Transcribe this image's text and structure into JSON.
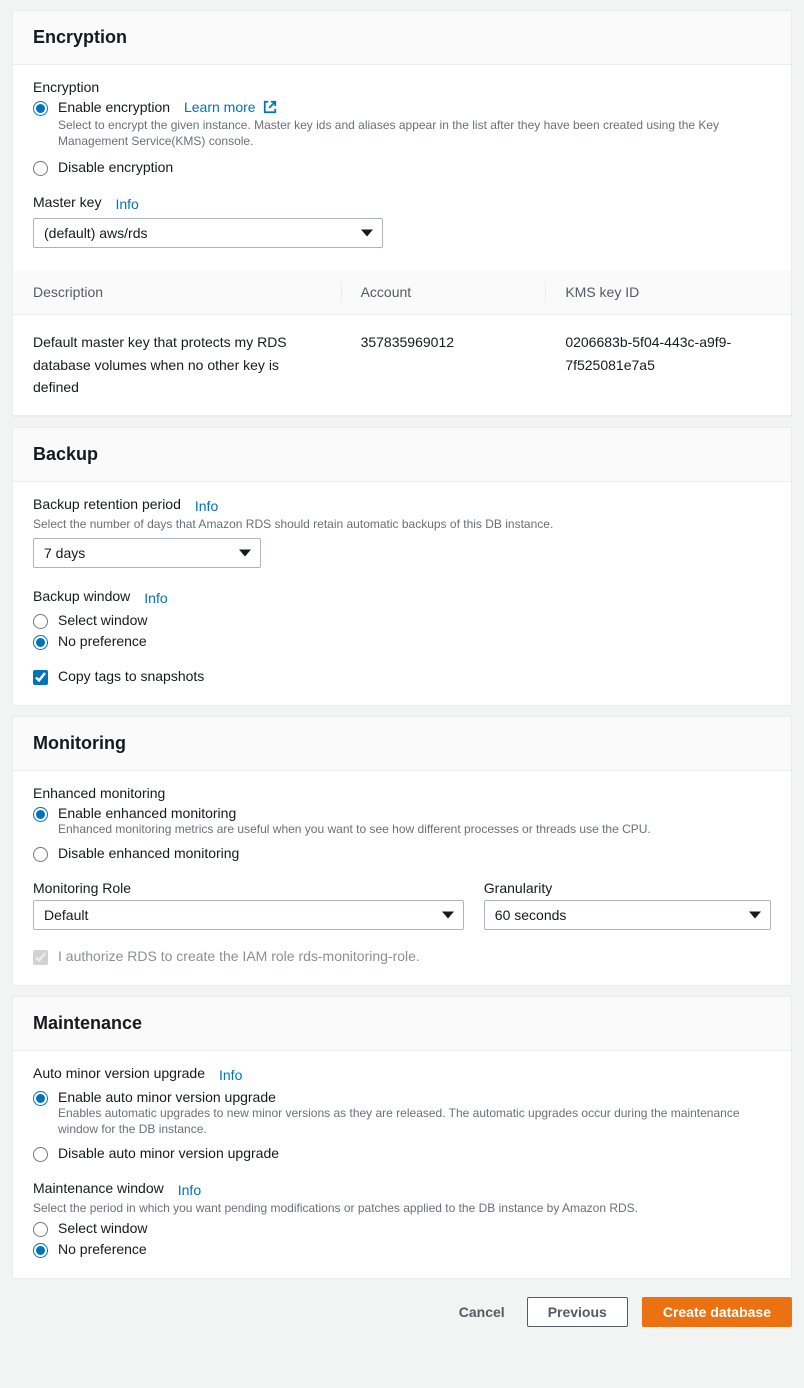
{
  "encryption": {
    "title": "Encryption",
    "sectionLabel": "Encryption",
    "enable": {
      "label": "Enable encryption",
      "learnMore": "Learn more",
      "help": "Select to encrypt the given instance. Master key ids and aliases appear in the list after they have been created using the Key Management Service(KMS) console."
    },
    "disable": {
      "label": "Disable encryption"
    },
    "masterKey": {
      "label": "Master key",
      "info": "Info",
      "value": "(default) aws/rds"
    },
    "table": {
      "headers": {
        "description": "Description",
        "account": "Account",
        "kmsKeyId": "KMS key ID"
      },
      "row": {
        "description": "Default master key that protects my RDS database volumes when no other key is defined",
        "account": "357835969012",
        "kmsKeyId": "0206683b-5f04-443c-a9f9-7f525081e7a5"
      }
    }
  },
  "backup": {
    "title": "Backup",
    "retention": {
      "label": "Backup retention period",
      "info": "Info",
      "help": "Select the number of days that Amazon RDS should retain automatic backups of this DB instance.",
      "value": "7 days"
    },
    "window": {
      "label": "Backup window",
      "info": "Info",
      "select": "Select window",
      "noPref": "No preference"
    },
    "copyTags": "Copy tags to snapshots"
  },
  "monitoring": {
    "title": "Monitoring",
    "sectionLabel": "Enhanced monitoring",
    "enable": {
      "label": "Enable enhanced monitoring",
      "help": "Enhanced monitoring metrics are useful when you want to see how different processes or threads use the CPU."
    },
    "disable": {
      "label": "Disable enhanced monitoring"
    },
    "role": {
      "label": "Monitoring Role",
      "value": "Default"
    },
    "granularity": {
      "label": "Granularity",
      "value": "60 seconds"
    },
    "iamAuthorize": "I authorize RDS to create the IAM role rds-monitoring-role."
  },
  "maintenance": {
    "title": "Maintenance",
    "upgrade": {
      "label": "Auto minor version upgrade",
      "info": "Info",
      "enable": {
        "label": "Enable auto minor version upgrade",
        "help": "Enables automatic upgrades to new minor versions as they are released. The automatic upgrades occur during the maintenance window for the DB instance."
      },
      "disable": {
        "label": "Disable auto minor version upgrade"
      }
    },
    "window": {
      "label": "Maintenance window",
      "info": "Info",
      "help": "Select the period in which you want pending modifications or patches applied to the DB instance by Amazon RDS.",
      "select": "Select window",
      "noPref": "No preference"
    }
  },
  "footer": {
    "cancel": "Cancel",
    "previous": "Previous",
    "create": "Create database"
  }
}
